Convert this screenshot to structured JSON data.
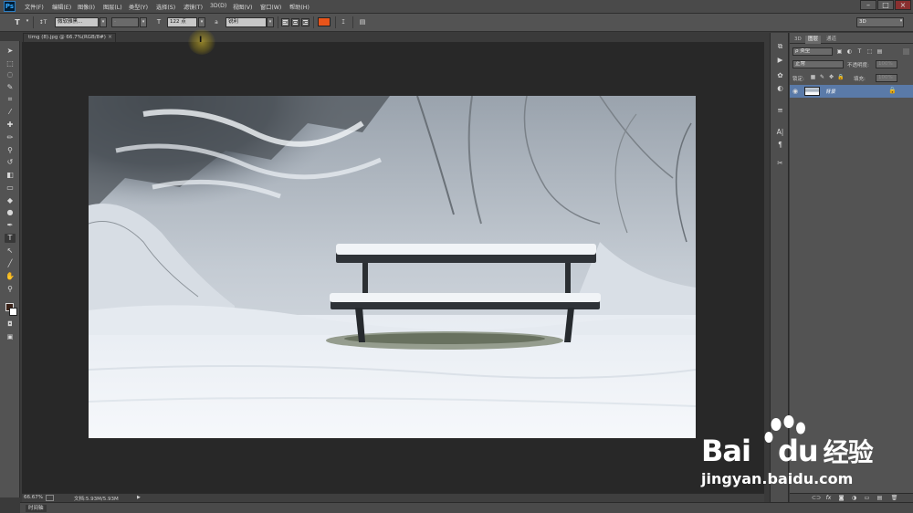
{
  "app": {
    "logo": "Ps"
  },
  "menu": [
    "文件(F)",
    "编辑(E)",
    "图像(I)",
    "图层(L)",
    "类型(Y)",
    "选择(S)",
    "滤镜(T)",
    "3D(D)",
    "视图(V)",
    "窗口(W)",
    "帮助(H)"
  ],
  "window_buttons": {
    "minimize": "–",
    "maximize": "□",
    "close": "×"
  },
  "options": {
    "tool_icon": "T",
    "orientation_icon": "↕T",
    "font_family": "微软雅黑...",
    "font_style": "-",
    "size_icon": "T",
    "font_size": "122 点",
    "aa_label": "a",
    "aa_value": "锐利",
    "text_color": "#e8541a",
    "workspace": "3D"
  },
  "tools": [
    {
      "name": "move-tool-icon",
      "glyph": "➤"
    },
    {
      "name": "marquee-tool-icon",
      "glyph": "⬚"
    },
    {
      "name": "lasso-tool-icon",
      "glyph": "◌"
    },
    {
      "name": "quick-select-tool-icon",
      "glyph": "✎"
    },
    {
      "name": "crop-tool-icon",
      "glyph": "⌗"
    },
    {
      "name": "eyedropper-tool-icon",
      "glyph": "⁄"
    },
    {
      "name": "healing-brush-tool-icon",
      "glyph": "✚"
    },
    {
      "name": "brush-tool-icon",
      "glyph": "✏"
    },
    {
      "name": "clone-stamp-tool-icon",
      "glyph": "⚲"
    },
    {
      "name": "history-brush-tool-icon",
      "glyph": "↺"
    },
    {
      "name": "eraser-tool-icon",
      "glyph": "◧"
    },
    {
      "name": "gradient-tool-icon",
      "glyph": "▭"
    },
    {
      "name": "blur-tool-icon",
      "glyph": "◆"
    },
    {
      "name": "dodge-tool-icon",
      "glyph": "●"
    },
    {
      "name": "pen-tool-icon",
      "glyph": "✒"
    },
    {
      "name": "type-tool-icon",
      "glyph": "T"
    },
    {
      "name": "path-select-tool-icon",
      "glyph": "↖"
    },
    {
      "name": "line-tool-icon",
      "glyph": "╱"
    },
    {
      "name": "hand-tool-icon",
      "glyph": "✋"
    },
    {
      "name": "zoom-tool-icon",
      "glyph": "⚲"
    }
  ],
  "quickmask": {
    "mask_glyph": "◘",
    "screen_glyph": "▣"
  },
  "document": {
    "tab_label": "timg (8).jpg @ 66.7%(RGB/8#)",
    "close": "×"
  },
  "cursor": {
    "glyph": "I"
  },
  "status": {
    "zoom": "66.67%",
    "doc_info": "文档:5.93M/5.93M",
    "arrow": "▶"
  },
  "timeline": {
    "label": "时间轴"
  },
  "panel_icons": [
    {
      "name": "history-panel-icon",
      "glyph": "⧉"
    },
    {
      "name": "actions-panel-icon",
      "glyph": "▶"
    },
    {
      "name": "brush-preset-panel-icon",
      "glyph": "✿"
    },
    {
      "name": "adjustments-panel-icon",
      "glyph": "◐"
    },
    {
      "name": "properties-panel-icon",
      "glyph": "≡"
    },
    {
      "name": "character-panel-icon",
      "glyph": "A|"
    },
    {
      "name": "paragraph-panel-icon",
      "glyph": "¶"
    },
    {
      "name": "tool-preset-panel-icon",
      "glyph": "✂"
    }
  ],
  "layers_panel": {
    "tabs": [
      "3D",
      "图层",
      "通道"
    ],
    "kind_label": "ρ 类型",
    "blend_mode": "正常",
    "opacity_label": "不透明度:",
    "opacity_value": "100%",
    "lock_label": "锁定:",
    "fill_label": "填充:",
    "fill_value": "100%",
    "layer_name": "背景",
    "bottom_icons": [
      "⊂⊃",
      "fx",
      "◙",
      "◑",
      "▭",
      "▤",
      "🗑"
    ]
  },
  "watermark": {
    "brand_left": "Bai",
    "brand_right": "du",
    "brand_cn": "经验",
    "url": "jingyan.baidu.com"
  }
}
